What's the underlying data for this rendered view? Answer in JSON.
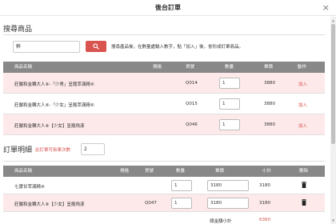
{
  "header": {
    "title": "後台訂單",
    "close": "×"
  },
  "search": {
    "section_title": "搜尋商品",
    "input_value": "粹",
    "hint": "搜尋產品後，在數量處輸入數字，點「加入」後，會形成訂單商品。"
  },
  "product_table": {
    "columns": [
      "商品名稱",
      "規格",
      "貨號",
      "數量",
      "單價",
      "動作"
    ],
    "rows": [
      {
        "name": "莊嚴和金轉大人⑥-「少男」呈龍萃滿精⑥",
        "spec": "",
        "code": "Q014",
        "qty": "1",
        "price": "3880",
        "action": "加入"
      },
      {
        "name": "莊嚴和金轉大人⑥-「少女」呈鳳萃滿精⑥",
        "spec": "",
        "code": "Q015",
        "qty": "1",
        "price": "3880",
        "action": "加入"
      },
      {
        "name": "莊嚴和金轉大人⑥【少女】呈鳳飛漾",
        "spec": "",
        "code": "Q046",
        "qty": "1",
        "price": "3880",
        "action": "加入"
      }
    ]
  },
  "order": {
    "section_title": "訂單明細",
    "link": "此訂單可拆單次數",
    "count": "2",
    "columns": [
      "商品名稱",
      "規格",
      "貨號",
      "數量",
      "單價",
      "小計",
      "刪除"
    ],
    "rows": [
      {
        "name": "七寶甘萃滿精⑥",
        "spec": "",
        "code": "",
        "qty": "1",
        "price": "3180",
        "subtotal": "3180"
      },
      {
        "name": "莊嚴和金轉大人⑥【少女】呈鳳飛漾",
        "spec": "",
        "code": "Q047",
        "qty": "1",
        "price": "3180",
        "subtotal": "3180"
      }
    ],
    "subtotal_label": "總金額小計",
    "subtotal_value": "6360"
  },
  "colors": {
    "accent": "#d9534f",
    "header_gray": "#888888",
    "row_pink": "#fde9ea"
  }
}
